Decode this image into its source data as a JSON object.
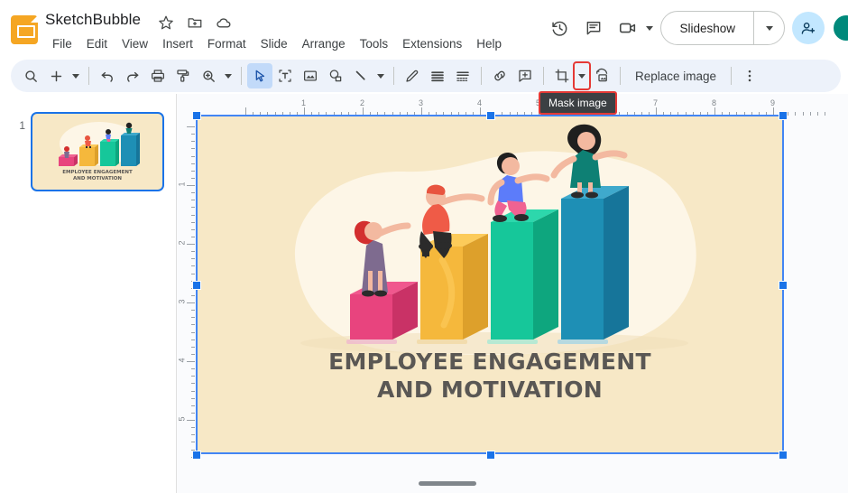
{
  "app": {
    "logo_icon": "slides-logo-icon",
    "doc_title": "SketchBubble",
    "title_icons": [
      "star-icon",
      "move-to-folder-icon",
      "cloud-saved-icon"
    ]
  },
  "menubar": {
    "items": [
      {
        "label": "File"
      },
      {
        "label": "Edit"
      },
      {
        "label": "View"
      },
      {
        "label": "Insert"
      },
      {
        "label": "Format"
      },
      {
        "label": "Slide"
      },
      {
        "label": "Arrange"
      },
      {
        "label": "Tools"
      },
      {
        "label": "Extensions"
      },
      {
        "label": "Help"
      }
    ]
  },
  "header_right": {
    "history_icon": "version-history-icon",
    "comment_icon": "comment-history-icon",
    "present_icon": "video-camera-icon",
    "present_caret_icon": "chevron-down-icon",
    "slideshow_label": "Slideshow",
    "slideshow_caret_icon": "chevron-down-icon",
    "share_icon": "add-person-icon",
    "avatar_label": "",
    "avatar_color": "#00897b"
  },
  "toolbar": {
    "items": [
      {
        "name": "search-icon",
        "kind": "icon"
      },
      {
        "name": "new-slide-icon",
        "kind": "icon"
      },
      {
        "name": "new-slide-caret-icon",
        "kind": "caret"
      },
      {
        "name": "separator-1",
        "kind": "sep"
      },
      {
        "name": "undo-icon",
        "kind": "icon"
      },
      {
        "name": "redo-icon",
        "kind": "icon"
      },
      {
        "name": "print-icon",
        "kind": "icon"
      },
      {
        "name": "paint-format-icon",
        "kind": "icon"
      },
      {
        "name": "zoom-icon",
        "kind": "icon"
      },
      {
        "name": "zoom-caret-icon",
        "kind": "caret"
      },
      {
        "name": "separator-2",
        "kind": "sep"
      },
      {
        "name": "select-tool-icon",
        "kind": "icon",
        "active": true
      },
      {
        "name": "text-box-icon",
        "kind": "icon"
      },
      {
        "name": "insert-image-icon",
        "kind": "icon"
      },
      {
        "name": "shape-icon",
        "kind": "icon"
      },
      {
        "name": "line-icon",
        "kind": "icon"
      },
      {
        "name": "line-caret-icon",
        "kind": "caret"
      },
      {
        "name": "separator-3",
        "kind": "sep"
      },
      {
        "name": "pen-icon",
        "kind": "icon"
      },
      {
        "name": "line-spacing-icon",
        "kind": "icon"
      },
      {
        "name": "transition-icon",
        "kind": "icon"
      },
      {
        "name": "separator-4",
        "kind": "sep"
      },
      {
        "name": "insert-link-icon",
        "kind": "icon"
      },
      {
        "name": "add-comment-icon",
        "kind": "icon"
      },
      {
        "name": "separator-5",
        "kind": "sep"
      },
      {
        "name": "crop-image-icon",
        "kind": "icon"
      },
      {
        "name": "mask-image-caret-icon",
        "kind": "caret",
        "highlighted": true
      },
      {
        "name": "reset-image-icon",
        "kind": "icon"
      },
      {
        "name": "separator-6",
        "kind": "sep"
      },
      {
        "name": "replace-image-button",
        "kind": "text",
        "label": "Replace image"
      },
      {
        "name": "separator-7",
        "kind": "sep"
      },
      {
        "name": "more-options-icon",
        "kind": "icon"
      }
    ],
    "replace_image_label": "Replace image"
  },
  "tooltip": {
    "text": "Mask image",
    "border_color": "#e53935",
    "background": "#3c4043"
  },
  "filmstrip": {
    "slides": [
      {
        "number": "1",
        "selected": true
      }
    ]
  },
  "rulers": {
    "horizontal_labels": [
      "1",
      "2",
      "3",
      "4",
      "5",
      "6",
      "7",
      "8",
      "9"
    ],
    "vertical_labels": [
      "1",
      "2",
      "3",
      "4",
      "5"
    ],
    "units": "inches"
  },
  "slide": {
    "background_color": "#F7E8C6",
    "title_line1": "EMPLOYEE ENGAGEMENT",
    "title_line2": "AND MOTIVATION",
    "title_color": "#5A5754",
    "selected": true,
    "selection_color": "#4285f4"
  },
  "illustration": {
    "name": "employee-engagement-bars-illustration",
    "blob_color": "#FDF6E7",
    "bars": [
      {
        "name": "bar-pink",
        "color": "#E8447E",
        "top_color": "#F06292",
        "side_color": "#C93266",
        "left_pct": 19.5,
        "bottom_pct": 17.5,
        "width_pct": 11.0,
        "height_pct": 15.5
      },
      {
        "name": "bar-yellow",
        "color": "#F5B83C",
        "top_color": "#FCCB5A",
        "side_color": "#DDA02B",
        "left_pct": 32.0,
        "bottom_pct": 17.0,
        "width_pct": 11.5,
        "height_pct": 33.5
      },
      {
        "name": "bar-teal",
        "color": "#16C79A",
        "top_color": "#2DD7AC",
        "side_color": "#0EA67E",
        "left_pct": 45.0,
        "bottom_pct": 17.5,
        "width_pct": 11.5,
        "height_pct": 43.0
      },
      {
        "name": "bar-blue",
        "color": "#1E8FB5",
        "top_color": "#3FA9CC",
        "side_color": "#16759A",
        "left_pct": 58.0,
        "bottom_pct": 18.0,
        "width_pct": 11.5,
        "height_pct": 52.0
      }
    ],
    "people": [
      {
        "name": "person-red-dress",
        "hair_color": "#D32F2F",
        "body_color": "#7E6B8F"
      },
      {
        "name": "person-orange-shirt",
        "hair_color": "#E8543F",
        "body_color": "#EF5B47"
      },
      {
        "name": "person-pink-pants",
        "hair_color": "#1f1f1f",
        "body_color": "#5C7CFA"
      },
      {
        "name": "person-green-dress",
        "hair_color": "#1f1f1f",
        "body_color": "#0E8074"
      }
    ]
  },
  "scrollbar": {
    "name": "horizontal-scrollbar"
  }
}
